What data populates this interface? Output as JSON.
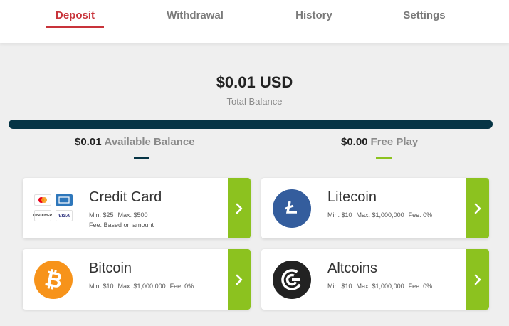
{
  "tabs": [
    {
      "label": "Deposit",
      "active": true
    },
    {
      "label": "Withdrawal",
      "active": false
    },
    {
      "label": "History",
      "active": false
    },
    {
      "label": "Settings",
      "active": false
    }
  ],
  "balance": {
    "amount": "$0.01 USD",
    "label": "Total Balance"
  },
  "sub_balances": {
    "available": {
      "amount": "$0.01",
      "label": "Available Balance",
      "color": "#063445"
    },
    "free_play": {
      "amount": "$0.00",
      "label": "Free Play",
      "color": "#8cc21f"
    }
  },
  "methods": {
    "credit_card": {
      "title": "Credit Card",
      "min": "Min: $25",
      "max": "Max: $500",
      "fee": "Fee: Based on amount",
      "icon": "credit-card-logos"
    },
    "litecoin": {
      "title": "Litecoin",
      "min": "Min: $10",
      "max": "Max: $1,000,000",
      "fee": "Fee: 0%",
      "icon": "litecoin-icon",
      "color": "#345d9d"
    },
    "bitcoin": {
      "title": "Bitcoin",
      "min": "Min: $10",
      "max": "Max: $1,000,000",
      "fee": "Fee: 0%",
      "icon": "bitcoin-icon",
      "color": "#f7931a"
    },
    "altcoins": {
      "title": "Altcoins",
      "min": "Min: $10",
      "max": "Max: $1,000,000",
      "fee": "Fee: 0%",
      "icon": "altcoins-icon",
      "color": "#222222"
    }
  },
  "card_logos": {
    "discover": "DISCOVER",
    "visa": "VISA"
  },
  "colors": {
    "accent_red": "#c8333a",
    "arrow_green": "#8cc21f",
    "bar_navy": "#063445"
  }
}
